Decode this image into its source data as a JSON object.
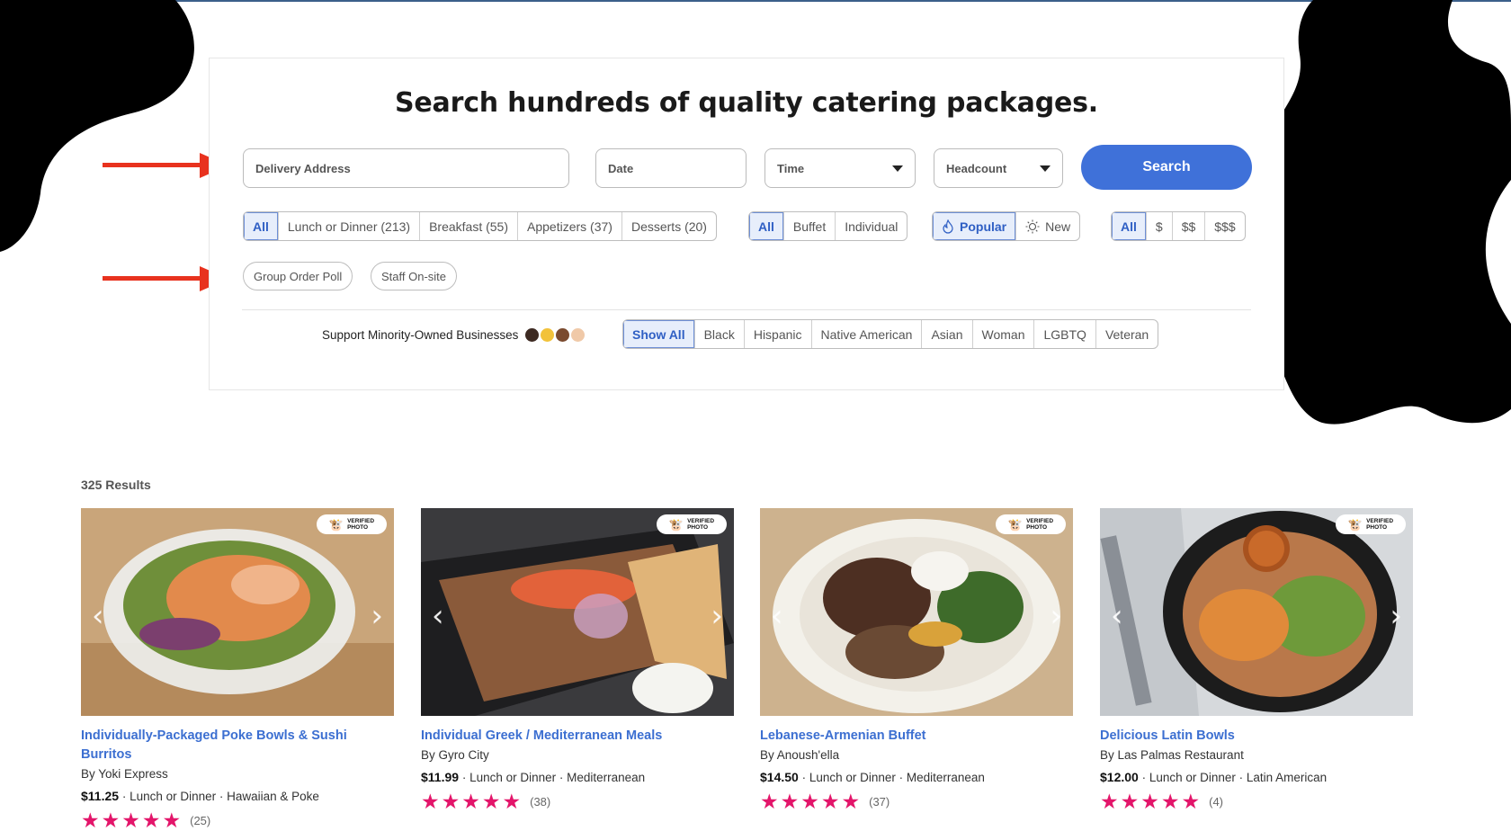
{
  "hero": {
    "title": "Search hundreds of quality catering packages."
  },
  "search": {
    "address_placeholder": "Delivery Address",
    "date_placeholder": "Date",
    "time_label": "Time",
    "headcount_label": "Headcount",
    "search_button": "Search"
  },
  "filters": {
    "meal_types": [
      "All",
      "Lunch or Dinner (213)",
      "Breakfast (55)",
      "Appetizers (37)",
      "Desserts (20)"
    ],
    "service_types": [
      "All",
      "Buffet",
      "Individual"
    ],
    "sort": [
      "Popular",
      "New"
    ],
    "price": [
      "All",
      "$",
      "$$",
      "$$$"
    ],
    "features": [
      "Group Order Poll",
      "Staff On-site"
    ],
    "minority_label": "Support Minority-Owned Businesses",
    "minority": [
      "Show All",
      "Black",
      "Hispanic",
      "Native American",
      "Asian",
      "Woman",
      "LGBTQ",
      "Veteran"
    ]
  },
  "colors": {
    "accent": "#3f71d9",
    "link": "#3c6fd1",
    "star": "#e3156a",
    "arrow": "#e8321e"
  },
  "results": {
    "count_label": "325 Results",
    "verified_badge": [
      "VERIFIED",
      "PHOTO"
    ],
    "cards": [
      {
        "title": "Individually-Packaged Poke Bowls & Sushi Burritos",
        "by": "By Yoki Express",
        "price": "$11.25",
        "meal": "Lunch or Dinner",
        "cuisine": "Hawaiian & Poke",
        "rating": 5,
        "reviews": "(25)"
      },
      {
        "title": "Individual Greek / Mediterranean Meals",
        "by": "By Gyro City",
        "price": "$11.99",
        "meal": "Lunch or Dinner",
        "cuisine": "Mediterranean",
        "rating": 5,
        "reviews": "(38)"
      },
      {
        "title": "Lebanese-Armenian Buffet",
        "by": "By Anoush'ella",
        "price": "$14.50",
        "meal": "Lunch or Dinner",
        "cuisine": "Mediterranean",
        "rating": 5,
        "reviews": "(37)"
      },
      {
        "title": "Delicious Latin Bowls",
        "by": "By Las Palmas Restaurant",
        "price": "$12.00",
        "meal": "Lunch or Dinner",
        "cuisine": "Latin American",
        "rating": 5,
        "reviews": "(4)"
      }
    ]
  }
}
